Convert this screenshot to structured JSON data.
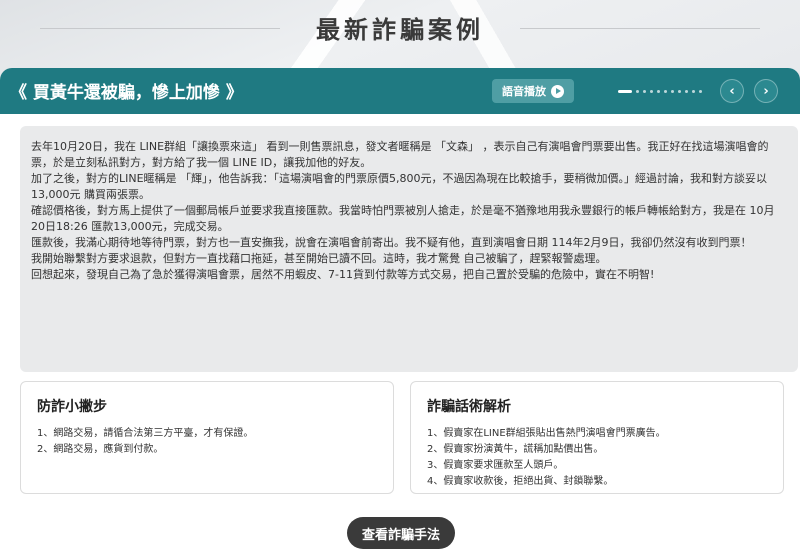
{
  "header": {
    "title": "最新詐騙案例"
  },
  "case": {
    "title": "《 買黃牛還被騙，慘上加慘 》",
    "audio_label": "語音播放",
    "pager": {
      "current": 1,
      "total": 11
    }
  },
  "story": {
    "paragraphs": [
      "去年10月20日，我在 LINE群組「讓換票來這」 看到一則售票訊息，發文者暱稱是 「文森」 ，表示自己有演唱會門票要出售。我正好在找這場演唱會的票，於是立刻私訊對方，對方給了我一個 LINE ID，讓我加他的好友。",
      "加了之後，對方的LINE暱稱是 「輝」，他告訴我：「這場演唱會的門票原價5,800元，不過因為現在比較搶手，要稍微加價。」經過討論，我和對方談妥以13,000元 購買兩張票。",
      "確認價格後，對方馬上提供了一個郵局帳戶並要求我直接匯款。我當時怕門票被別人搶走，於是毫不猶豫地用我永豐銀行的帳戶轉帳給對方，我是在 10月20日18:26 匯款13,000元，完成交易。",
      "匯款後，我滿心期待地等待門票，對方也一直安撫我，說會在演唱會前寄出。我不疑有他，直到演唱會日期 114年2月9日，我卻仍然沒有收到門票！",
      "我開始聯繫對方要求退款，但對方一直找藉口拖延，甚至開始已讀不回。這時，我才驚覺 自己被騙了，趕緊報警處理。",
      "回想起來，發現自己為了急於獲得演唱會票，居然不用蝦皮、7-11貨到付款等方式交易，把自己置於受騙的危險中，實在不明智!"
    ]
  },
  "tips": {
    "title": "防詐小撇步",
    "items": [
      "1、網路交易，請循合法第三方平臺，才有保證。",
      "2、網路交易，應貨到付款。"
    ]
  },
  "analysis": {
    "title": "詐騙話術解析",
    "items": [
      "1、假賣家在LINE群組張貼出售熱門演唱會門票廣告。",
      "2、假賣家扮演黃牛，謊稱加點價出售。",
      "3、假賣家要求匯款至人頭戶。",
      "4、假賣家收款後，拒絕出貨、封鎖聯繫。"
    ]
  },
  "footer": {
    "button_label": "查看詐騙手法"
  },
  "colors": {
    "teal": "#1f7a82",
    "story_bg": "#e9eaeb",
    "button_dark": "#3a3a3a"
  }
}
